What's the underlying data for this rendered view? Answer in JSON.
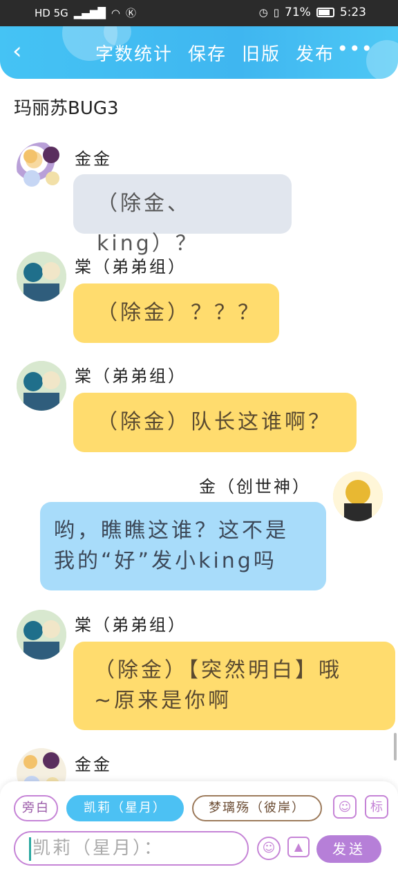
{
  "status_bar": {
    "network": "HD 5G",
    "battery_percent": "71%",
    "time": "5:23"
  },
  "header": {
    "back_icon": "chevron-left-icon",
    "actions": [
      "字数统计",
      "保存",
      "旧版",
      "发布"
    ],
    "more_icon": "more-dots-icon"
  },
  "doc_title": "玛丽苏BUG3",
  "messages": [
    {
      "sender": "金金",
      "text": "（除金、king）？",
      "style": "gray",
      "side": "left"
    },
    {
      "sender": "棠（弟弟组）",
      "text": "（除金）？？？",
      "style": "yellow",
      "side": "left"
    },
    {
      "sender": "棠（弟弟组）",
      "text": "（除金）队长这谁啊？",
      "style": "yellow",
      "side": "left"
    },
    {
      "sender": "金（创世神）",
      "line1": "哟，瞧瞧这谁？这不是",
      "line2": "我的“好”发小king吗",
      "style": "blue",
      "side": "right"
    },
    {
      "sender": "棠（弟弟组）",
      "line1": "（除金）【突然明白】哦",
      "line2": "~原来是你啊",
      "style": "yellow",
      "side": "left"
    },
    {
      "sender": "金金",
      "side": "left"
    }
  ],
  "bottom": {
    "chips": [
      "旁白",
      "凯莉（星月）",
      "梦璃殇（彼岸）"
    ],
    "person_icon": "person-icon",
    "tag_label": "标",
    "input_value": "凯莉（星月）：",
    "emoji_icon": "emoji-icon",
    "image_icon": "image-icon",
    "send_label": "发送"
  }
}
